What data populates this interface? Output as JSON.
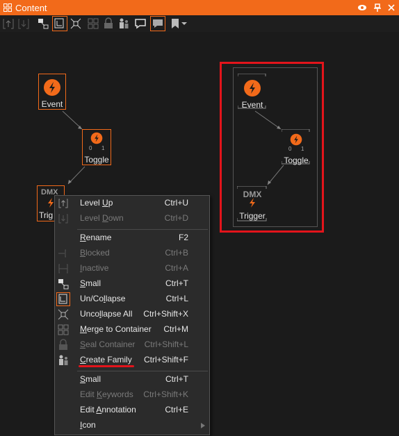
{
  "window": {
    "title": "Content"
  },
  "toolbar": {
    "icons": [
      "level-up-icon",
      "level-down-icon",
      "small-icon",
      "uncollapse-icon",
      "uncollapse-all-icon",
      "merge-icon",
      "seal-icon",
      "family-icon",
      "annotation-icon",
      "annotation-active-icon",
      "bookmark-icon",
      "dropdown-icon"
    ]
  },
  "canvas": {
    "nodes": {
      "event": {
        "label": "Event"
      },
      "toggle": {
        "label": "Toggle",
        "bit_off": "0",
        "bit_on": "1"
      },
      "trigger": {
        "label": "Trigger",
        "dmx": "DMX",
        "partial_label": "Trig"
      }
    },
    "family": {
      "event": {
        "label": "Event"
      },
      "toggle": {
        "label": "Toggle",
        "bit_off": "0",
        "bit_on": "1"
      },
      "trigger": {
        "label": "Trigger",
        "dmx": "DMX"
      }
    }
  },
  "context_menu": {
    "items": [
      {
        "pre": "Level ",
        "ul": "U",
        "post": "p",
        "shortcut": "Ctrl+U",
        "enabled": true
      },
      {
        "pre": "Level ",
        "ul": "D",
        "post": "own",
        "shortcut": "Ctrl+D",
        "enabled": false
      },
      {
        "pre": "",
        "ul": "R",
        "post": "ename",
        "shortcut": "F2",
        "enabled": true
      },
      {
        "pre": "",
        "ul": "B",
        "post": "locked",
        "shortcut": "Ctrl+B",
        "enabled": false
      },
      {
        "pre": "",
        "ul": "I",
        "post": "nactive",
        "shortcut": "Ctrl+A",
        "enabled": false
      },
      {
        "pre": "",
        "ul": "S",
        "post": "mall",
        "shortcut": "Ctrl+T",
        "enabled": true
      },
      {
        "pre": "Un/Co",
        "ul": "l",
        "post": "lapse",
        "shortcut": "Ctrl+L",
        "enabled": true
      },
      {
        "pre": "Unco",
        "ul": "l",
        "post": "lapse All",
        "shortcut": "Ctrl+Shift+X",
        "enabled": true
      },
      {
        "pre": "",
        "ul": "M",
        "post": "erge to Container",
        "shortcut": "Ctrl+M",
        "enabled": true
      },
      {
        "pre": "",
        "ul": "S",
        "post": "eal Container",
        "shortcut": "Ctrl+Shift+L",
        "enabled": false
      },
      {
        "pre": "",
        "ul": "C",
        "post": "reate Family",
        "shortcut": "Ctrl+Shift+F",
        "enabled": true
      },
      {
        "pre": "",
        "ul": "S",
        "post": "mall",
        "shortcut": "Ctrl+T",
        "enabled": true
      },
      {
        "pre": "Edit ",
        "ul": "K",
        "post": "eywords",
        "shortcut": "Ctrl+Shift+K",
        "enabled": false
      },
      {
        "pre": "Edit ",
        "ul": "A",
        "post": "nnotation",
        "shortcut": "Ctrl+E",
        "enabled": true
      },
      {
        "pre": "",
        "ul": "I",
        "post": "con",
        "shortcut": "",
        "enabled": true
      }
    ]
  },
  "colors": {
    "accent": "#f26a1a",
    "highlight": "#e3141b",
    "background": "#1b1b1b",
    "menu_bg": "#2b2b2b"
  }
}
